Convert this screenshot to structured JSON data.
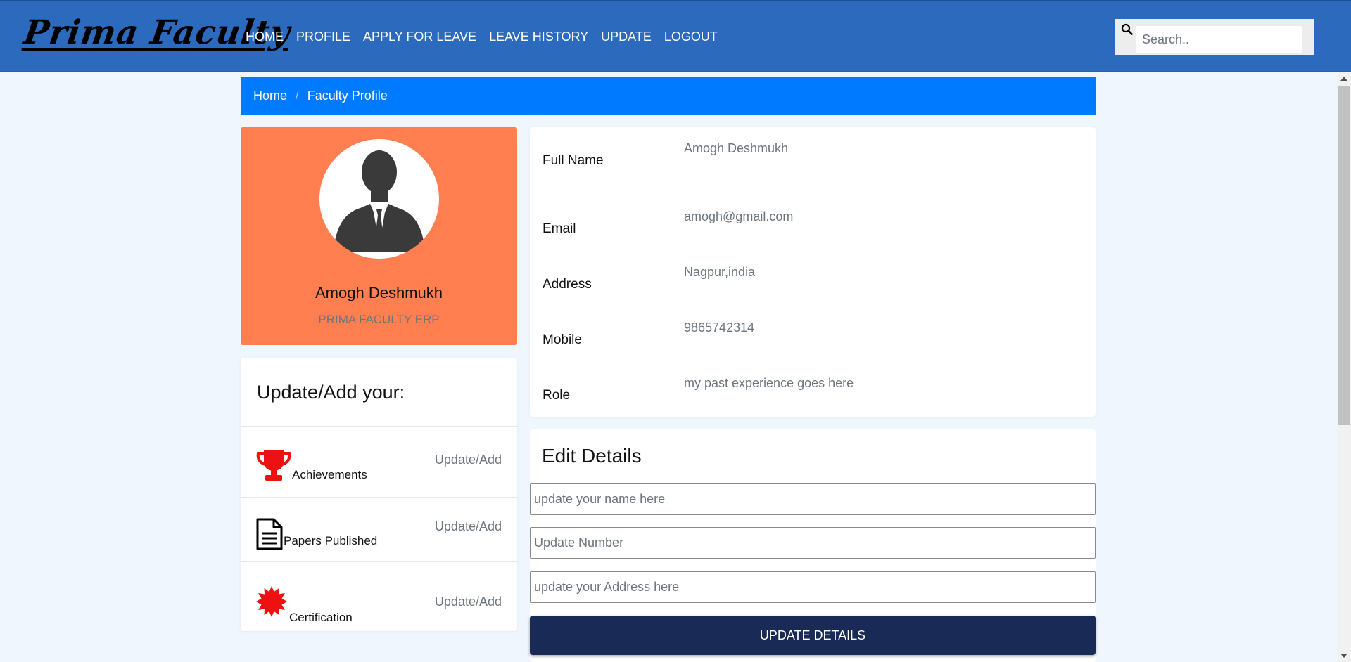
{
  "navbar": {
    "brand": "Prima Faculty",
    "links": [
      "HOME",
      "PROFILE",
      "APPLY FOR LEAVE",
      "LEAVE HISTORY",
      "UPDATE",
      "LOGOUT"
    ],
    "search_placeholder": "Search..",
    "color": "#2b6abd"
  },
  "breadcrumb": {
    "items": [
      "Home",
      "Faculty Profile"
    ],
    "separator": "/",
    "color": "#007bff"
  },
  "profile": {
    "name": "Amogh Deshmukh",
    "org": "PRIMA FACULTY ERP",
    "card_color": "#ff7f50"
  },
  "add_section": {
    "title": "Update/Add your:",
    "rows": [
      {
        "label": "Achievements",
        "action": "Update/Add",
        "icon": "trophy-icon"
      },
      {
        "label": "Papers Published",
        "action": "Update/Add",
        "icon": "document-icon"
      },
      {
        "label": "Certification",
        "action": "Update/Add",
        "icon": "badge-icon"
      }
    ]
  },
  "info": {
    "fields": [
      {
        "label": "Full Name",
        "value": "Amogh Deshmukh"
      },
      {
        "label": "Email",
        "value": "amogh@gmail.com"
      },
      {
        "label": "Address",
        "value": "Nagpur,india"
      },
      {
        "label": "Mobile",
        "value": "9865742314"
      },
      {
        "label": "Role",
        "value": "my past experience goes here"
      }
    ]
  },
  "edit": {
    "title": "Edit Details",
    "name_placeholder": "update your name here",
    "number_placeholder": "Update Number",
    "address_placeholder": "update your Address here",
    "button_label": "UPDATE DETAILS",
    "button_color": "#1a2a56"
  }
}
